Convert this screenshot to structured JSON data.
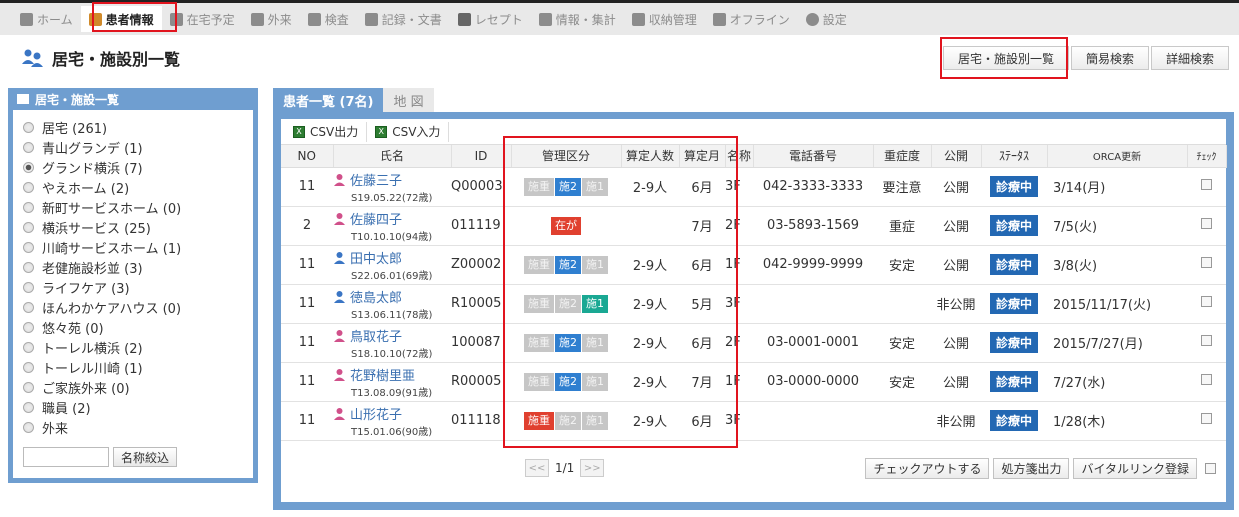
{
  "nav": {
    "items": [
      {
        "label": "ホーム",
        "icon": "home-icon",
        "active": false
      },
      {
        "label": "患者情報",
        "icon": "patient-icon",
        "active": true
      },
      {
        "label": "在宅予定",
        "icon": "calendar-icon",
        "active": false
      },
      {
        "label": "外来",
        "icon": "person-icon",
        "active": false
      },
      {
        "label": "検査",
        "icon": "chart-icon",
        "active": false
      },
      {
        "label": "記録・文書",
        "icon": "document-icon",
        "active": false
      },
      {
        "label": "レセプト",
        "icon": "receipt-icon",
        "active": false
      },
      {
        "label": "情報・集計",
        "icon": "stats-icon",
        "active": false
      },
      {
        "label": "収納管理",
        "icon": "billing-icon",
        "active": false
      },
      {
        "label": "オフライン",
        "icon": "offline-icon",
        "active": false
      },
      {
        "label": "設定",
        "icon": "gear-icon",
        "active": false
      }
    ]
  },
  "header": {
    "title": "居宅・施設別一覧",
    "buttons": [
      "居宅・施設別一覧",
      "簡易検索",
      "詳細検索"
    ]
  },
  "left": {
    "heading": "居宅・施設一覧",
    "facilities": [
      {
        "label": "居宅 (261)",
        "checked": false
      },
      {
        "label": "青山グランデ (1)",
        "checked": false
      },
      {
        "label": "グランド横浜 (7)",
        "checked": true
      },
      {
        "label": "やえホーム (2)",
        "checked": false
      },
      {
        "label": "新町サービスホーム (0)",
        "checked": false
      },
      {
        "label": "横浜サービス (25)",
        "checked": false
      },
      {
        "label": "川崎サービスホーム (1)",
        "checked": false
      },
      {
        "label": "老健施設杉並 (3)",
        "checked": false
      },
      {
        "label": "ライフケア (3)",
        "checked": false
      },
      {
        "label": "ほんわかケアハウス (0)",
        "checked": false
      },
      {
        "label": "悠々苑 (0)",
        "checked": false
      },
      {
        "label": "トーレル横浜 (2)",
        "checked": false
      },
      {
        "label": "トーレル川崎 (1)",
        "checked": false
      },
      {
        "label": "ご家族外来 (0)",
        "checked": false
      },
      {
        "label": "職員 (2)",
        "checked": false
      },
      {
        "label": "外来",
        "checked": false
      }
    ],
    "filter_value": "",
    "filter_button": "名称絞込"
  },
  "tabs": [
    {
      "label": "患者一覧 (7名)",
      "active": true
    },
    {
      "label": "地 図",
      "active": false
    }
  ],
  "toolbar": {
    "csv_out": "CSV出力",
    "csv_in": "CSV入力"
  },
  "columns": [
    "NO",
    "氏名",
    "ID",
    "管理区分",
    "算定人数",
    "算定月",
    "名称",
    "電話番号",
    "重症度",
    "公開",
    "ｽﾃｰﾀｽ",
    "ORCA更新",
    "ﾁｪｯｸ"
  ],
  "rows": [
    {
      "no": "11",
      "name": "佐藤三子",
      "sub": "S19.05.22(72歳)",
      "gender": "female",
      "id": "Q00003",
      "badges": [
        {
          "t": "施重",
          "c": "gray"
        },
        {
          "t": "施2",
          "c": "blue"
        },
        {
          "t": "施1",
          "c": "gray"
        }
      ],
      "count": "2-9人",
      "month": "6月",
      "floor": "3F",
      "phone": "042-3333-3333",
      "severity": "要注意",
      "public": "公開",
      "status": "診療中",
      "orca": "3/14(月)"
    },
    {
      "no": "2",
      "name": "佐藤四子",
      "sub": "T10.10.10(94歳)",
      "gender": "female",
      "id": "011119",
      "badges": [
        {
          "t": "在が",
          "c": "red"
        }
      ],
      "count": "",
      "month": "7月",
      "floor": "2F",
      "phone": "03-5893-1569",
      "severity": "重症",
      "public": "公開",
      "status": "診療中",
      "orca": "7/5(火)"
    },
    {
      "no": "11",
      "name": "田中太郎",
      "sub": "S22.06.01(69歳)",
      "gender": "male",
      "id": "Z00002",
      "badges": [
        {
          "t": "施重",
          "c": "gray"
        },
        {
          "t": "施2",
          "c": "blue"
        },
        {
          "t": "施1",
          "c": "gray"
        }
      ],
      "count": "2-9人",
      "month": "6月",
      "floor": "1F",
      "phone": "042-9999-9999",
      "severity": "安定",
      "public": "公開",
      "status": "診療中",
      "orca": "3/8(火)"
    },
    {
      "no": "11",
      "name": "徳島太郎",
      "sub": "S13.06.11(78歳)",
      "gender": "male",
      "id": "R10005",
      "badges": [
        {
          "t": "施重",
          "c": "gray"
        },
        {
          "t": "施2",
          "c": "gray"
        },
        {
          "t": "施1",
          "c": "teal"
        }
      ],
      "count": "2-9人",
      "month": "5月",
      "floor": "3F",
      "phone": "",
      "severity": "",
      "public": "非公開",
      "status": "診療中",
      "orca": "2015/11/17(火)"
    },
    {
      "no": "11",
      "name": "鳥取花子",
      "sub": "S18.10.10(72歳)",
      "gender": "female",
      "id": "100087",
      "badges": [
        {
          "t": "施重",
          "c": "gray"
        },
        {
          "t": "施2",
          "c": "blue"
        },
        {
          "t": "施1",
          "c": "gray"
        }
      ],
      "count": "2-9人",
      "month": "6月",
      "floor": "2F",
      "phone": "03-0001-0001",
      "severity": "安定",
      "public": "公開",
      "status": "診療中",
      "orca": "2015/7/27(月)"
    },
    {
      "no": "11",
      "name": "花野樹里亜",
      "sub": "T13.08.09(91歳)",
      "gender": "female",
      "id": "R00005",
      "badges": [
        {
          "t": "施重",
          "c": "gray"
        },
        {
          "t": "施2",
          "c": "blue"
        },
        {
          "t": "施1",
          "c": "gray"
        }
      ],
      "count": "2-9人",
      "month": "7月",
      "floor": "1F",
      "phone": "03-0000-0000",
      "severity": "安定",
      "public": "公開",
      "status": "診療中",
      "orca": "7/27(水)"
    },
    {
      "no": "11",
      "name": "山形花子",
      "sub": "T15.01.06(90歳)",
      "gender": "female",
      "id": "011118",
      "badges": [
        {
          "t": "施重",
          "c": "red"
        },
        {
          "t": "施2",
          "c": "gray"
        },
        {
          "t": "施1",
          "c": "gray"
        }
      ],
      "count": "2-9人",
      "month": "6月",
      "floor": "3F",
      "phone": "",
      "severity": "",
      "public": "非公開",
      "status": "診療中",
      "orca": "1/28(木)"
    }
  ],
  "pager": {
    "prev": "<<",
    "label": "1/1",
    "next": ">>"
  },
  "bottom_buttons": [
    "チェックアウトする",
    "処方箋出力",
    "バイタルリンク登録"
  ],
  "colors": {
    "panel": "#6f9ed0",
    "status": "#2368b3",
    "highlight": "#e1141e"
  }
}
